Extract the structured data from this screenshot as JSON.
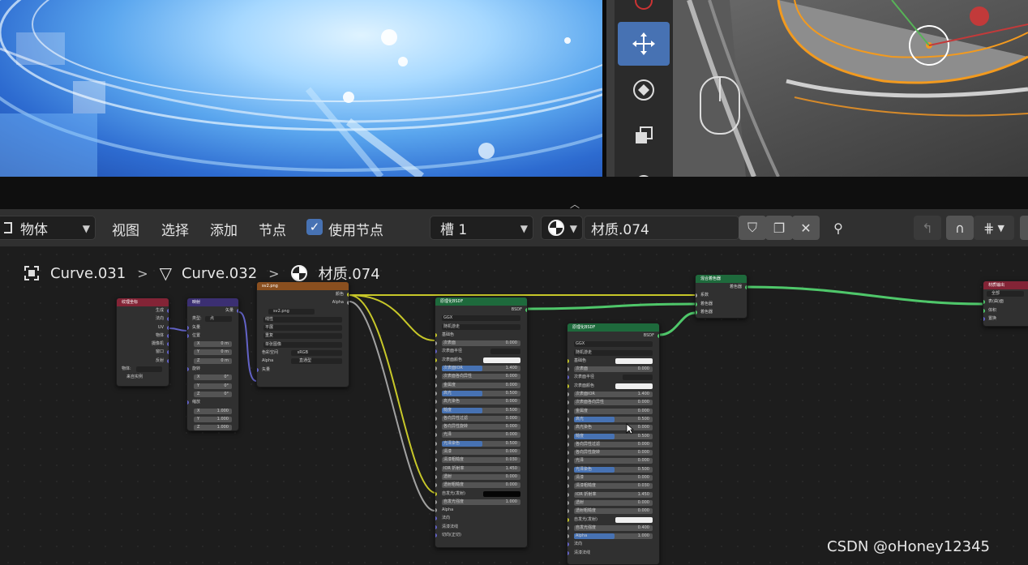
{
  "header": {
    "mode_select": "物体",
    "menu": [
      "视图",
      "选择",
      "添加",
      "节点"
    ],
    "use_nodes_label": "使用节点",
    "slot_select": "槽 1",
    "material_name": "材质.074"
  },
  "breadcrumb": {
    "object": "Curve.031",
    "mesh": "Curve.032",
    "material": "材质.074"
  },
  "nodes": {
    "texcoord": {
      "title": "纹理坐标",
      "outputs": [
        "生成",
        "法向",
        "UV",
        "物体",
        "摄像机",
        "窗口",
        "反射"
      ],
      "object_label": "物体:",
      "from_instancer": "来自实例"
    },
    "mapping": {
      "title": "映射",
      "output": "矢量",
      "type_label": "类型:",
      "type_value": "点",
      "vector": "矢量",
      "location": "位置",
      "loc_values": [
        [
          "X",
          "0 m"
        ],
        [
          "Y",
          "0 m"
        ],
        [
          "Z",
          "0 m"
        ]
      ],
      "rotation": "旋转",
      "rot_values": [
        [
          "X",
          "0°"
        ],
        [
          "Y",
          "0°"
        ],
        [
          "Z",
          "0°"
        ]
      ],
      "scale": "缩放",
      "scale_values": [
        [
          "X",
          "1.000"
        ],
        [
          "Y",
          "1.000"
        ],
        [
          "Z",
          "1.000"
        ]
      ]
    },
    "image": {
      "title": "sv2.png",
      "outputs": [
        "颜色",
        "Alpha"
      ],
      "file": "sv2.png",
      "settings": [
        "线性",
        "平展",
        "重复",
        "单张图像"
      ],
      "colorspace_label": "色彩空间",
      "colorspace_value": "sRGB",
      "alpha_label": "Alpha",
      "alpha_value": "直通型",
      "input": "矢量"
    },
    "bsdf1": {
      "title": "原理化BSDF",
      "output": "BSDF",
      "dist": "GGX",
      "sss": "随机游走",
      "rows": [
        [
          "基础色",
          "",
          "plain"
        ],
        [
          "次表面",
          "0.000",
          "field"
        ],
        [
          "次表面半径",
          "",
          "dark"
        ],
        [
          "次表面颜色",
          "",
          "white"
        ],
        [
          "次表面IOR",
          "1.400",
          "fill"
        ],
        [
          "次表面各向异性",
          "0.000",
          "field"
        ],
        [
          "金属度",
          "0.000",
          "field"
        ],
        [
          "高光",
          "0.500",
          "fill"
        ],
        [
          "高光染色",
          "0.000",
          "field"
        ],
        [
          "糙度",
          "0.500",
          "fill"
        ],
        [
          "各向异性过滤",
          "0.000",
          "field"
        ],
        [
          "各向异性旋转",
          "0.000",
          "field"
        ],
        [
          "光泽",
          "0.000",
          "field"
        ],
        [
          "光泽染色",
          "0.500",
          "fill"
        ],
        [
          "清漆",
          "0.000",
          "field"
        ],
        [
          "清漆粗糙度",
          "0.030",
          "field"
        ],
        [
          "IOR 折射率",
          "1.450",
          "field"
        ],
        [
          "透射",
          "0.000",
          "field"
        ],
        [
          "透射粗糙度",
          "0.000",
          "field"
        ],
        [
          "自发光(发射)",
          "",
          "black"
        ],
        [
          "自发光强度",
          "1.000",
          "field"
        ],
        [
          "Alpha",
          "",
          "plain"
        ],
        [
          "法向",
          "",
          "plain"
        ],
        [
          "清漆法线",
          "",
          "plain"
        ],
        [
          "切向(正切)",
          "",
          "plain"
        ]
      ]
    },
    "bsdf2": {
      "title": "原理化BSDF",
      "output": "BSDF",
      "dist": "GGX",
      "sss": "随机游走",
      "rows": [
        [
          "基础色",
          "",
          "white"
        ],
        [
          "次表面",
          "0.000",
          "field"
        ],
        [
          "次表面半径",
          "",
          "dark"
        ],
        [
          "次表面颜色",
          "",
          "white"
        ],
        [
          "次表面IOR",
          "1.400",
          "field"
        ],
        [
          "次表面各向异性",
          "0.000",
          "field"
        ],
        [
          "金属度",
          "0.000",
          "field"
        ],
        [
          "高光",
          "0.500",
          "fill"
        ],
        [
          "高光染色",
          "0.000",
          "field"
        ],
        [
          "糙度",
          "0.500",
          "fill"
        ],
        [
          "各向异性过滤",
          "0.000",
          "field"
        ],
        [
          "各向异性旋转",
          "0.000",
          "field"
        ],
        [
          "光泽",
          "0.000",
          "field"
        ],
        [
          "光泽染色",
          "0.500",
          "fill"
        ],
        [
          "清漆",
          "0.000",
          "field"
        ],
        [
          "清漆粗糙度",
          "0.030",
          "field"
        ],
        [
          "IOR 折射率",
          "1.450",
          "field"
        ],
        [
          "透射",
          "0.000",
          "field"
        ],
        [
          "透射粗糙度",
          "0.000",
          "field"
        ],
        [
          "自发光(发射)",
          "",
          "white"
        ],
        [
          "自发光强度",
          "0.400",
          "field"
        ],
        [
          "Alpha",
          "1.000",
          "fill"
        ],
        [
          "法向",
          "",
          "plain"
        ],
        [
          "清漆法线",
          "",
          "plain"
        ]
      ]
    },
    "mix": {
      "title": "混合着色器",
      "output": "着色器",
      "inputs": [
        "系数",
        "着色器",
        "着色器"
      ]
    },
    "output": {
      "title": "材质输出",
      "target": "全部",
      "inputs": [
        "表(曲)面",
        "体积",
        "置换"
      ]
    }
  },
  "watermark": "CSDN @oHoney12345",
  "colors": {
    "accent": "#4772b3",
    "link_yellow": "#c7c729",
    "link_green": "#4fc76a",
    "link_purple": "#6363c7",
    "link_grey": "#a1a1a1"
  }
}
